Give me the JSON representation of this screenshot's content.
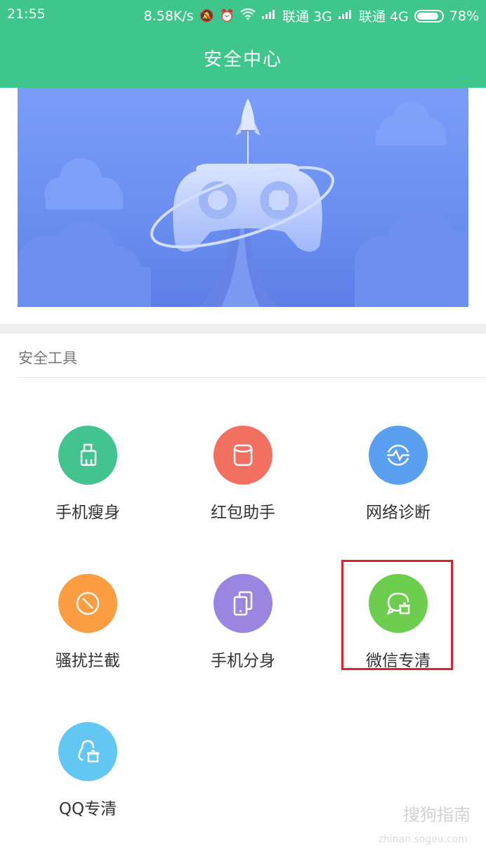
{
  "status_bar": {
    "time": "21:55",
    "speed": "8.58K/s",
    "carrier1": "联通 3G",
    "carrier2": "联通 4G",
    "battery": "78%"
  },
  "header": {
    "title": "安全中心",
    "bg_color": "#3fc68d"
  },
  "section": {
    "title": "安全工具"
  },
  "tools": [
    {
      "label": "手机瘦身",
      "icon": "broom-icon",
      "color": "#43c38f"
    },
    {
      "label": "红包助手",
      "icon": "cylinder-icon",
      "color": "#f2705f"
    },
    {
      "label": "网络诊断",
      "icon": "network-pulse-icon",
      "color": "#5a9ff0"
    },
    {
      "label": "骚扰拦截",
      "icon": "block-icon",
      "color": "#fb9d40"
    },
    {
      "label": "手机分身",
      "icon": "dual-phone-icon",
      "color": "#9a85e0"
    },
    {
      "label": "微信专清",
      "icon": "chat-trash-icon",
      "color": "#6dcd4f"
    },
    {
      "label": "QQ专清",
      "icon": "qq-trash-icon",
      "color": "#62c7f3"
    }
  ],
  "watermark": {
    "text": "搜狗指南",
    "sub": "zhinan.sogou.com"
  }
}
